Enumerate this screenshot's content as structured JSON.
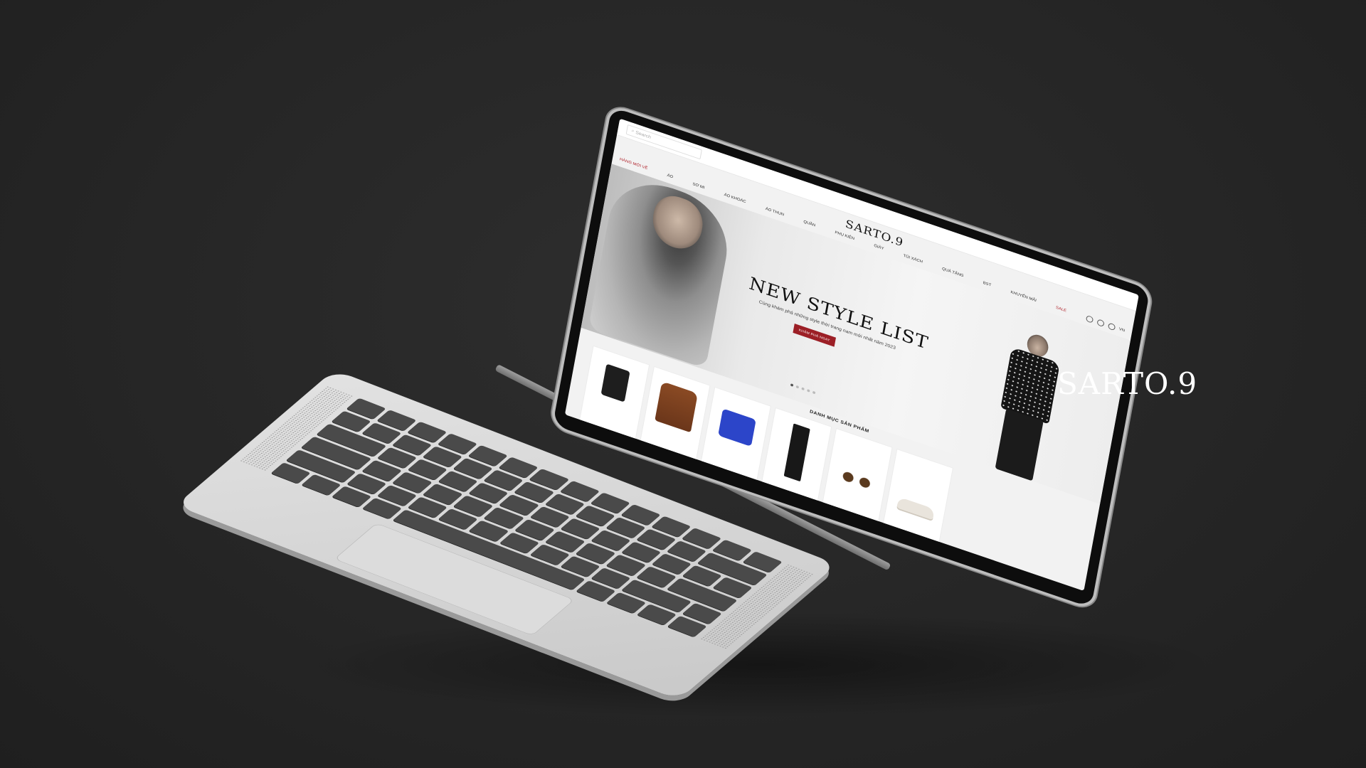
{
  "brand": {
    "name": "SARTO.9"
  },
  "website": {
    "search_placeholder": "Search",
    "logo": "SARTO.9",
    "nav": {
      "items": [
        "HÀNG MỚI VỀ",
        "ÁO",
        "SƠ MI",
        "ÁO KHOÁC",
        "ÁO THUN",
        "QUẦN",
        "PHỤ KIỆN",
        "GIÀY",
        "TÚI XÁCH",
        "QUÀ TẶNG",
        "BST",
        "KHUYẾN MÃI",
        "SALE"
      ],
      "accent_first": "HÀNG MỚI VỀ",
      "language": "VN"
    },
    "hero": {
      "title": "NEW STYLE LIST",
      "subtitle": "Cùng khám phá những style thời trang nam mới nhất năm 2023",
      "cta_label": "KHÁM PHÁ NGAY",
      "slides": 5,
      "active_slide": 1
    },
    "section_title": "DANH MỤC SẢN PHẨM",
    "products": [
      {
        "icon": "bag-icon"
      },
      {
        "icon": "jacket-icon"
      },
      {
        "icon": "tshirt-icon"
      },
      {
        "icon": "pants-icon"
      },
      {
        "icon": "sunglasses-icon"
      },
      {
        "icon": "sneaker-icon"
      }
    ]
  },
  "colors": {
    "background": "#262626",
    "accent": "#9c1f26",
    "brand_text": "#ffffff"
  }
}
